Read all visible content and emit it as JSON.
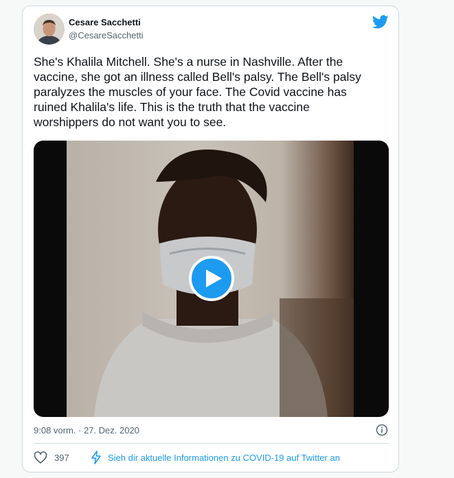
{
  "tweet": {
    "author_name": "Cesare Sacchetti",
    "author_handle": "@CesareSacchetti",
    "text": "She's Khalila Mitchell. She's a nurse in Nashville. After the\nvaccine, she got an illness called Bell's palsy. The Bell's palsy\nparalyzes the muscles of your face. The Covid vaccine has\nruined Khalila's life. This is the truth that the vaccine\nworshippers do not want you to see.",
    "timestamp": "9:08 vorm. · 27. Dez. 2020",
    "like_count": "397",
    "covid_notice": "Sieh dir aktuelle Informationen zu COVID-19 auf Twitter an"
  },
  "colors": {
    "accent": "#1d9bf0",
    "secondary_text": "#536471",
    "border": "#cfd9de"
  },
  "icons": {
    "logo": "twitter-bird-icon",
    "play": "play-icon",
    "info": "info-icon",
    "like": "heart-icon",
    "notice": "lightning-icon"
  }
}
